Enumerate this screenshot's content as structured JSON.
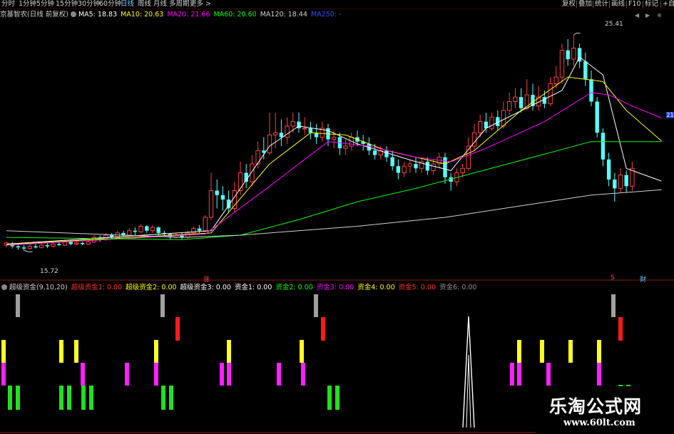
{
  "toolbar": {
    "periods": [
      "分时",
      "1分钟",
      "5分钟",
      "15分钟",
      "30分钟",
      "60分钟",
      "日线",
      "周线",
      "月线",
      "多周期",
      "更多 >"
    ],
    "active_period": "日线",
    "tools": [
      "复权",
      "叠加",
      "统计",
      "画线",
      "F10",
      "标记",
      "+自选"
    ],
    "right_icons": [
      "◀",
      "▶",
      "⊕"
    ]
  },
  "main_legend": {
    "title": "京基智农(日线 前复权)",
    "items": [
      {
        "label": "MA5: 18.83",
        "color": "#ffffff"
      },
      {
        "label": "MA10: 20.63",
        "color": "#ffff00"
      },
      {
        "label": "MA20: 21.66",
        "color": "#ff00ff"
      },
      {
        "label": "MA60: 20.60",
        "color": "#00ff00"
      },
      {
        "label": "MA120: 18.44",
        "color": "#d0d0d0"
      },
      {
        "label": "MA250: -",
        "color": "#3050ff"
      }
    ]
  },
  "sub_legend": {
    "title": "超级资金(9,10,20)",
    "items": [
      {
        "label": "超级资金1: 0.00",
        "color": "#ff3030"
      },
      {
        "label": "超级资金2: 0.00",
        "color": "#ffff00"
      },
      {
        "label": "超级资金3: 0.00",
        "color": "#ffffff"
      },
      {
        "label": "资金1: 0.00",
        "color": "#ffffff"
      },
      {
        "label": "资金2: 0.00",
        "color": "#00ff00"
      },
      {
        "label": "资金3: 0.00",
        "color": "#ff00ff"
      },
      {
        "label": "资金4: 0.00",
        "color": "#ffff00"
      },
      {
        "label": "资金5: 0.00",
        "color": "#ff3030"
      },
      {
        "label": "资金6: 0.00",
        "color": "#909090"
      }
    ]
  },
  "annotations": {
    "high_label": "25.41",
    "low_label": "15.72",
    "right_price_tag": "21",
    "zhang_tag": "涨",
    "s_tag": "S",
    "cai_tag": "财"
  },
  "watermark": {
    "title": "乐淘公式网",
    "url": "www.60lt.com"
  },
  "colors": {
    "up": "#ff4040",
    "down": "#54ffff",
    "ma5": "#ffffff",
    "ma10": "#ffff00",
    "ma20": "#ff00ff",
    "ma60": "#00ff00",
    "ma120": "#d0d0d0"
  },
  "chart_data": {
    "type": "candlestick",
    "stock": "京基智农",
    "period": "日线 前复权",
    "ylim": [
      14.8,
      26.0
    ],
    "price_labels": {
      "high": 25.41,
      "low": 15.72
    },
    "ma_last": {
      "MA5": 18.83,
      "MA10": 20.63,
      "MA20": 21.66,
      "MA60": 20.6,
      "MA120": 18.44
    },
    "candles": [
      [
        15.95,
        16.05,
        15.85,
        16.1
      ],
      [
        16.0,
        15.9,
        15.8,
        16.1
      ],
      [
        15.9,
        15.85,
        15.75,
        16.0
      ],
      [
        15.85,
        15.8,
        15.72,
        15.95
      ],
      [
        15.8,
        15.9,
        15.75,
        16.0
      ],
      [
        15.9,
        15.85,
        15.8,
        16.0
      ],
      [
        15.85,
        15.95,
        15.8,
        16.05
      ],
      [
        15.95,
        15.9,
        15.82,
        16.05
      ],
      [
        15.9,
        16.0,
        15.85,
        16.1
      ],
      [
        16.0,
        15.95,
        15.9,
        16.1
      ],
      [
        15.95,
        16.1,
        15.9,
        16.2
      ],
      [
        16.1,
        16.0,
        15.95,
        16.2
      ],
      [
        16.0,
        16.05,
        15.95,
        16.15
      ],
      [
        16.05,
        16.0,
        15.95,
        16.1
      ],
      [
        16.0,
        16.1,
        15.95,
        16.2
      ],
      [
        16.1,
        16.3,
        16.05,
        16.4
      ],
      [
        16.3,
        16.2,
        16.1,
        16.4
      ],
      [
        16.2,
        16.4,
        16.15,
        16.5
      ],
      [
        16.4,
        16.3,
        16.25,
        16.5
      ],
      [
        16.3,
        16.5,
        16.25,
        16.6
      ],
      [
        16.5,
        16.4,
        16.35,
        16.6
      ],
      [
        16.4,
        16.6,
        16.35,
        16.7
      ],
      [
        16.6,
        16.55,
        16.4,
        16.75
      ],
      [
        16.55,
        16.8,
        16.5,
        16.9
      ],
      [
        16.8,
        16.6,
        16.5,
        16.85
      ],
      [
        16.6,
        16.75,
        16.5,
        16.85
      ],
      [
        16.75,
        16.5,
        16.4,
        16.8
      ],
      [
        16.5,
        16.45,
        16.35,
        16.6
      ],
      [
        16.45,
        16.3,
        16.2,
        16.5
      ],
      [
        16.3,
        16.4,
        16.25,
        16.5
      ],
      [
        16.4,
        16.3,
        16.2,
        16.5
      ],
      [
        16.3,
        16.5,
        16.25,
        16.6
      ],
      [
        16.5,
        16.7,
        16.45,
        16.8
      ],
      [
        16.7,
        16.6,
        16.5,
        16.85
      ],
      [
        16.6,
        17.2,
        16.55,
        17.3
      ],
      [
        17.2,
        18.4,
        17.1,
        19.2
      ],
      [
        18.4,
        18.2,
        17.6,
        18.9
      ],
      [
        18.2,
        18.0,
        17.5,
        18.6
      ],
      [
        18.0,
        17.6,
        17.4,
        18.4
      ],
      [
        17.6,
        18.4,
        17.4,
        18.8
      ],
      [
        18.4,
        19.2,
        18.2,
        19.7
      ],
      [
        19.2,
        18.8,
        18.5,
        19.6
      ],
      [
        18.8,
        19.6,
        18.6,
        20.0
      ],
      [
        19.6,
        20.2,
        19.4,
        20.6
      ],
      [
        20.2,
        20.1,
        19.8,
        20.8
      ],
      [
        20.1,
        20.9,
        20.0,
        21.9
      ],
      [
        20.9,
        21.0,
        20.3,
        21.9
      ],
      [
        21.0,
        20.8,
        20.4,
        21.6
      ],
      [
        20.8,
        21.3,
        20.5,
        21.7
      ],
      [
        21.3,
        21.5,
        21.0,
        21.9
      ],
      [
        21.5,
        21.2,
        21.0,
        21.9
      ],
      [
        21.2,
        21.2,
        20.9,
        21.7
      ],
      [
        21.2,
        21.0,
        20.7,
        21.5
      ],
      [
        21.0,
        20.8,
        20.5,
        21.4
      ],
      [
        20.8,
        21.2,
        20.6,
        21.5
      ],
      [
        21.2,
        20.7,
        20.4,
        21.4
      ],
      [
        20.7,
        20.8,
        20.3,
        21.1
      ],
      [
        20.8,
        20.3,
        20.0,
        21.0
      ],
      [
        20.3,
        20.4,
        20.0,
        20.7
      ],
      [
        20.4,
        20.8,
        20.2,
        21.0
      ],
      [
        20.8,
        20.6,
        20.4,
        21.1
      ],
      [
        20.6,
        20.5,
        20.2,
        20.9
      ],
      [
        20.5,
        20.2,
        20.0,
        20.8
      ],
      [
        20.2,
        20.0,
        19.8,
        20.5
      ],
      [
        20.0,
        20.2,
        19.8,
        20.4
      ],
      [
        20.2,
        19.9,
        19.7,
        20.4
      ],
      [
        19.9,
        19.5,
        19.3,
        20.2
      ],
      [
        19.5,
        19.2,
        18.9,
        19.8
      ],
      [
        19.2,
        19.5,
        19.0,
        19.7
      ],
      [
        19.5,
        19.6,
        19.2,
        19.8
      ],
      [
        19.6,
        19.4,
        19.2,
        19.9
      ],
      [
        19.4,
        19.7,
        19.2,
        19.9
      ],
      [
        19.7,
        19.3,
        19.1,
        19.9
      ],
      [
        19.3,
        19.6,
        19.1,
        19.8
      ],
      [
        19.6,
        19.9,
        19.4,
        20.1
      ],
      [
        19.9,
        19.0,
        18.7,
        20.1
      ],
      [
        19.0,
        18.8,
        18.4,
        19.2
      ],
      [
        18.8,
        19.2,
        18.6,
        19.4
      ],
      [
        19.2,
        19.4,
        19.0,
        19.6
      ],
      [
        19.4,
        20.4,
        19.3,
        20.8
      ],
      [
        20.4,
        21.0,
        20.2,
        21.4
      ],
      [
        21.0,
        21.5,
        20.8,
        21.8
      ],
      [
        21.5,
        21.2,
        21.0,
        21.9
      ],
      [
        21.2,
        21.7,
        21.1,
        21.9
      ],
      [
        21.7,
        21.3,
        21.1,
        22.0
      ],
      [
        21.3,
        22.0,
        21.2,
        22.4
      ],
      [
        22.0,
        22.4,
        21.8,
        22.8
      ],
      [
        22.4,
        22.6,
        22.1,
        23.0
      ],
      [
        22.6,
        22.1,
        21.9,
        23.0
      ],
      [
        22.1,
        22.7,
        22.0,
        23.4
      ],
      [
        22.7,
        22.2,
        22.0,
        23.2
      ],
      [
        22.2,
        22.6,
        22.0,
        23.1
      ],
      [
        22.6,
        22.3,
        22.1,
        22.9
      ],
      [
        22.3,
        23.2,
        22.2,
        23.5
      ],
      [
        23.2,
        23.5,
        23.0,
        24.0
      ],
      [
        23.5,
        24.7,
        23.2,
        25.0
      ],
      [
        24.7,
        24.3,
        24.0,
        25.2
      ],
      [
        24.3,
        24.8,
        24.0,
        25.41
      ],
      [
        24.8,
        24.2,
        23.9,
        25.0
      ],
      [
        24.2,
        23.4,
        23.1,
        24.6
      ],
      [
        23.4,
        22.4,
        22.2,
        23.8
      ],
      [
        22.4,
        21.0,
        20.8,
        22.6
      ],
      [
        21.0,
        19.8,
        19.5,
        21.2
      ],
      [
        19.8,
        18.9,
        18.6,
        20.1
      ],
      [
        18.9,
        18.5,
        17.9,
        19.2
      ],
      [
        18.5,
        19.1,
        18.3,
        19.4
      ],
      [
        19.1,
        18.6,
        18.3,
        19.3
      ],
      [
        18.6,
        19.4,
        18.4,
        19.7
      ]
    ],
    "ma": {
      "MA5": [
        [
          0,
          16.0
        ],
        [
          35,
          16.6
        ],
        [
          45,
          20.4
        ],
        [
          50,
          21.3
        ],
        [
          55,
          21.1
        ],
        [
          60,
          20.5
        ],
        [
          70,
          19.7
        ],
        [
          76,
          19.3
        ],
        [
          82,
          21.2
        ],
        [
          95,
          22.9
        ],
        [
          98,
          24.4
        ],
        [
          102,
          23.6
        ],
        [
          106,
          19.4
        ],
        [
          112,
          18.83
        ]
      ],
      "MA10": [
        [
          0,
          15.98
        ],
        [
          35,
          16.5
        ],
        [
          45,
          19.6
        ],
        [
          52,
          21.0
        ],
        [
          58,
          20.9
        ],
        [
          65,
          20.2
        ],
        [
          75,
          19.6
        ],
        [
          80,
          20.2
        ],
        [
          88,
          22.0
        ],
        [
          96,
          23.5
        ],
        [
          102,
          23.3
        ],
        [
          106,
          22.0
        ],
        [
          112,
          20.63
        ]
      ],
      "MA20": [
        [
          0,
          15.95
        ],
        [
          34,
          16.45
        ],
        [
          45,
          18.6
        ],
        [
          55,
          20.6
        ],
        [
          62,
          20.4
        ],
        [
          70,
          19.9
        ],
        [
          76,
          19.7
        ],
        [
          82,
          20.3
        ],
        [
          92,
          21.5
        ],
        [
          100,
          22.8
        ],
        [
          103,
          22.7
        ],
        [
          107,
          22.2
        ],
        [
          112,
          21.66
        ]
      ],
      "MA60": [
        [
          0,
          16.3
        ],
        [
          30,
          16.2
        ],
        [
          40,
          16.4
        ],
        [
          50,
          17.1
        ],
        [
          60,
          17.9
        ],
        [
          70,
          18.5
        ],
        [
          80,
          19.2
        ],
        [
          90,
          19.9
        ],
        [
          100,
          20.6
        ],
        [
          112,
          20.6
        ]
      ],
      "MA120": [
        [
          0,
          16.6
        ],
        [
          30,
          16.3
        ],
        [
          40,
          16.4
        ],
        [
          60,
          16.8
        ],
        [
          75,
          17.2
        ],
        [
          90,
          17.8
        ],
        [
          100,
          18.2
        ],
        [
          112,
          18.44
        ]
      ]
    },
    "indicator": {
      "name": "超级资金",
      "params": "(9,10,20)",
      "gray_x": [
        25,
        228,
        443,
        860
      ],
      "red_x": [
        249,
        453,
        870
      ],
      "yellow_x": [
        5,
        86,
        107,
        219,
        321,
        423,
        728,
        760,
        800,
        840
      ],
      "magenta_x": [
        5,
        116,
        178,
        219,
        311,
        321,
        391,
        425,
        718,
        728,
        769,
        840
      ],
      "green_x": [
        14,
        25,
        86,
        97,
        117,
        128,
        229,
        240,
        462,
        473
      ],
      "spike_x": 657
    }
  }
}
